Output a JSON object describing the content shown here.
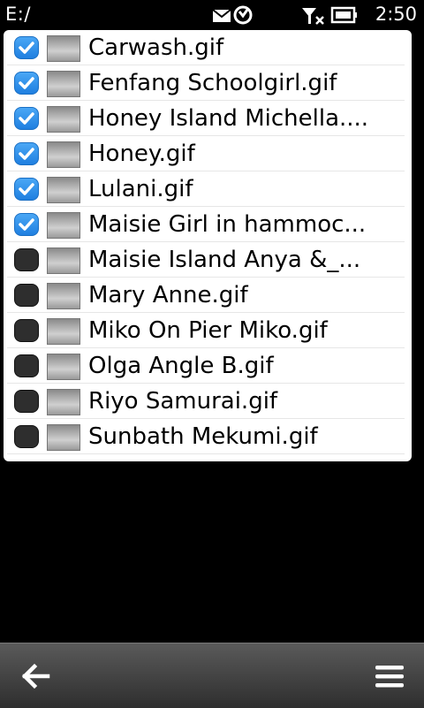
{
  "status": {
    "path": "E:/",
    "time": "2:50",
    "icons": [
      "message-icon",
      "sync-icon",
      "signal-off-icon",
      "battery-icon"
    ]
  },
  "files": [
    {
      "name": "Carwash.gif",
      "checked": true
    },
    {
      "name": "Fenfang Schoolgirl.gif",
      "checked": true
    },
    {
      "name": "Honey Island Michella....",
      "checked": true
    },
    {
      "name": "Honey.gif",
      "checked": true
    },
    {
      "name": "Lulani.gif",
      "checked": true
    },
    {
      "name": "Maisie Girl in hammoc...",
      "checked": true
    },
    {
      "name": "Maisie Island Anya &_...",
      "checked": false
    },
    {
      "name": "Mary Anne.gif",
      "checked": false
    },
    {
      "name": "Miko On Pier Miko.gif",
      "checked": false
    },
    {
      "name": "Olga Angle B.gif",
      "checked": false
    },
    {
      "name": "Riyo Samurai.gif",
      "checked": false
    },
    {
      "name": "Sunbath Mekumi.gif",
      "checked": false
    }
  ],
  "toolbar": {
    "back_icon": "back-arrow-icon",
    "menu_icon": "menu-icon"
  },
  "colors": {
    "checked": "#2a8be8",
    "unchecked": "#2e2e2e",
    "background": "#000000",
    "panel": "#ffffff"
  }
}
